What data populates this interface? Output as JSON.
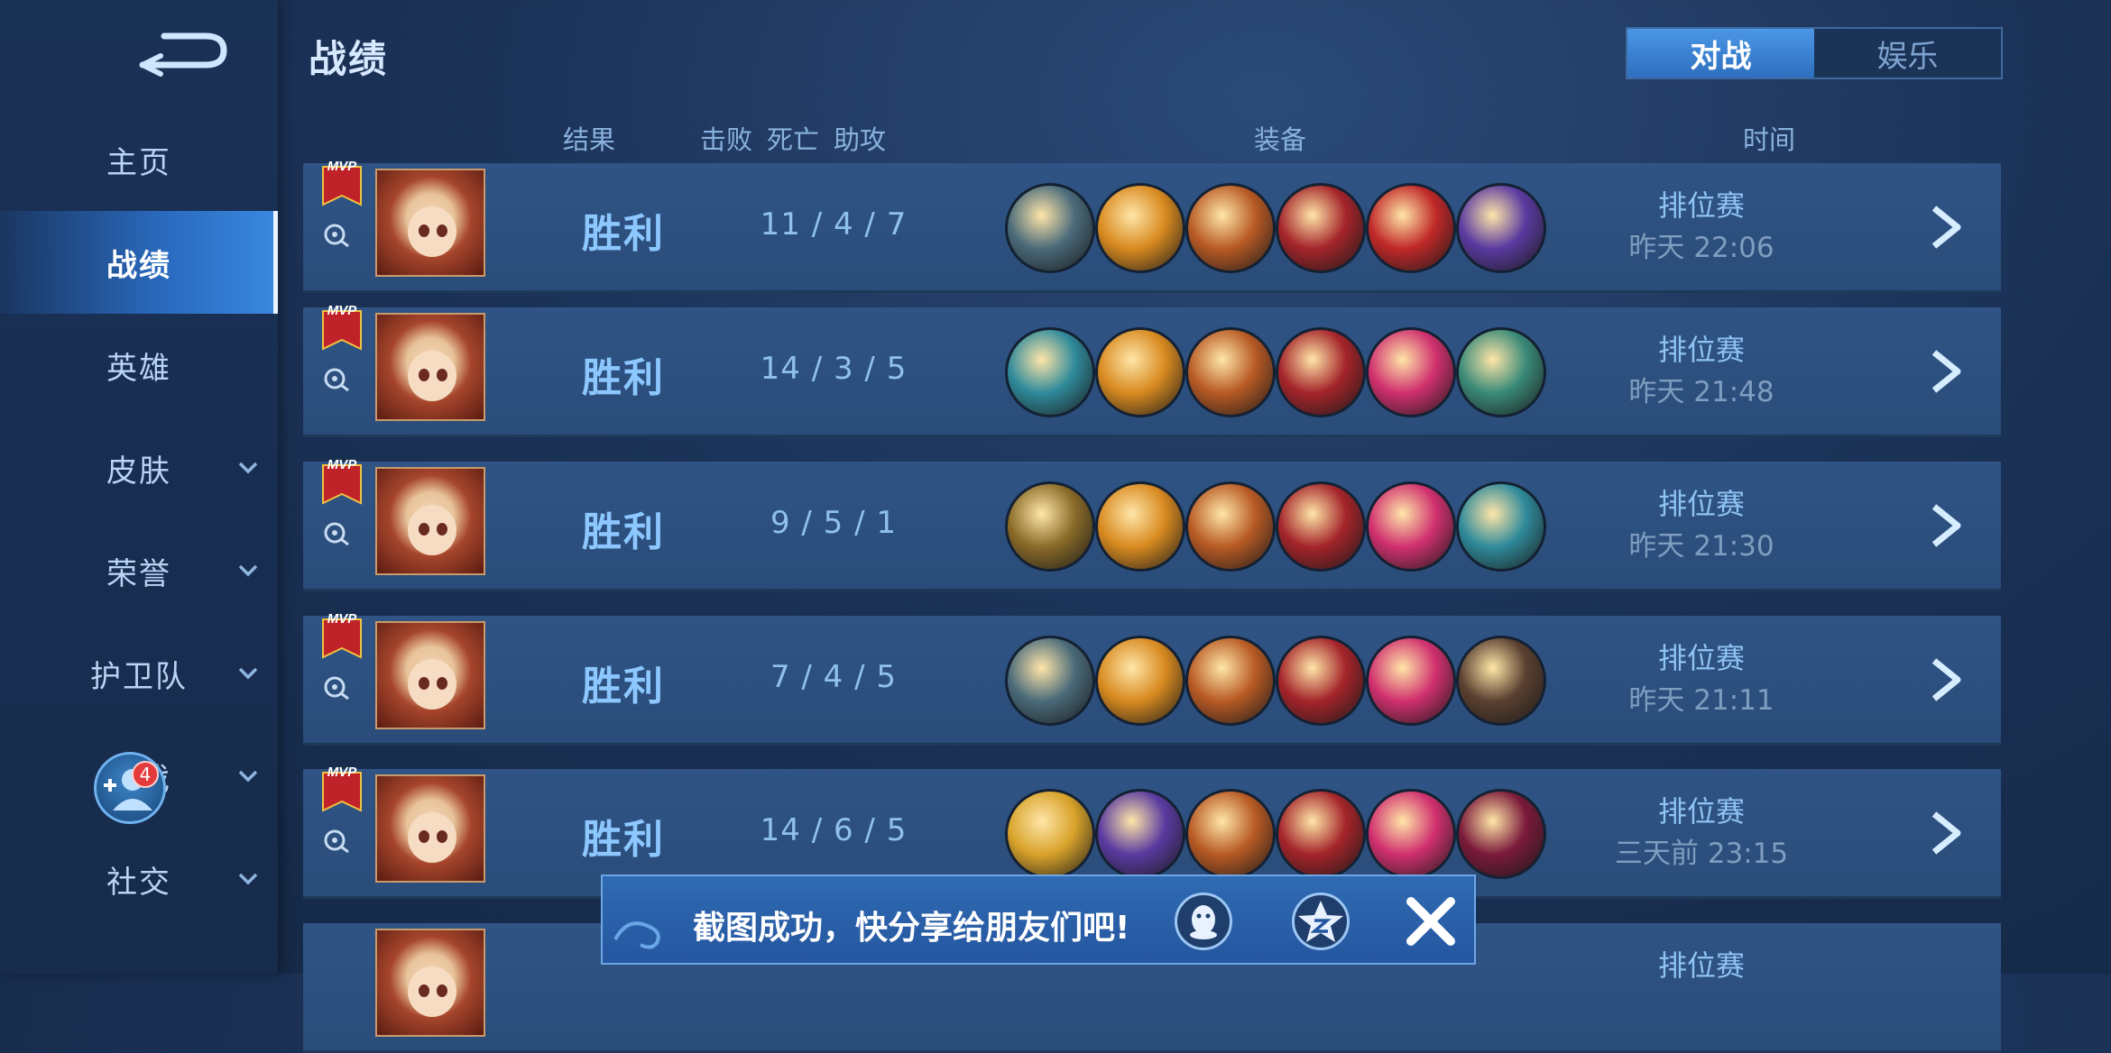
{
  "sidebar": {
    "items": [
      {
        "label": "主页",
        "has_chevron": false
      },
      {
        "label": "战绩",
        "has_chevron": false,
        "active": true
      },
      {
        "label": "英雄",
        "has_chevron": false
      },
      {
        "label": "皮肤",
        "has_chevron": true
      },
      {
        "label": "荣誉",
        "has_chevron": true
      },
      {
        "label": "护卫队",
        "has_chevron": true
      },
      {
        "label": "游戏",
        "has_chevron": true
      },
      {
        "label": "社交",
        "has_chevron": true
      }
    ],
    "friends_badge": "4"
  },
  "header": {
    "title": "战绩",
    "tabs": [
      "对战",
      "娱乐"
    ],
    "active_tab": "对战"
  },
  "columns": {
    "result": "结果",
    "kills": "击败",
    "deaths": "死亡",
    "assists": "助攻",
    "equipment": "装备",
    "time": "时间"
  },
  "matches": [
    {
      "mvp_label": "MVP",
      "result": "胜利",
      "kda": "11  /  4  /  7",
      "mode": "排位赛",
      "time": "昨天 22:06",
      "equipment": [
        "boots-steel",
        "golden-claw",
        "flame-blade",
        "crimson-blade",
        "red-helm",
        "void-spear"
      ]
    },
    {
      "mvp_label": "MVP",
      "result": "胜利",
      "kda": "14  /  3  /  5",
      "mode": "排位赛",
      "time": "昨天 21:48",
      "equipment": [
        "frost-sword",
        "golden-claw",
        "flame-blade",
        "crimson-blade",
        "pink-blade",
        "green-boots"
      ]
    },
    {
      "mvp_label": "MVP",
      "result": "胜利",
      "kda": "9  /  5  /  1",
      "mode": "排位赛",
      "time": "昨天 21:30",
      "equipment": [
        "gold-boots",
        "golden-claw",
        "flame-blade",
        "crimson-blade",
        "pink-blade",
        "frost-sword"
      ]
    },
    {
      "mvp_label": "MVP",
      "result": "胜利",
      "kda": "7  /  4  /  5",
      "mode": "排位赛",
      "time": "昨天 21:11",
      "equipment": [
        "boots-steel",
        "golden-claw",
        "flame-blade",
        "crimson-blade",
        "pink-blade",
        "leather-boots"
      ]
    },
    {
      "mvp_label": "MVP",
      "result": "胜利",
      "kda": "14  /  6  /  5",
      "mode": "排位赛",
      "time": "三天前 23:15",
      "equipment": [
        "golden-arrow",
        "void-spear",
        "flame-blade",
        "crimson-blade",
        "pink-blade",
        "dark-blade"
      ]
    },
    {
      "mvp_label": "",
      "result": "",
      "kda": "",
      "mode": "排位赛",
      "time": "",
      "equipment": []
    }
  ],
  "toast": {
    "text": "截图成功，快分享给朋友们吧!",
    "share_targets": [
      "qq-icon",
      "qzone-icon"
    ]
  },
  "colors": {
    "accent": "#3a89e0",
    "win": "#8cc8ff",
    "equipment": {
      "boots-steel": "#4a6a7a",
      "golden-claw": "#d88a20",
      "flame-blade": "#b85a24",
      "crimson-blade": "#a4242a",
      "red-helm": "#c02828",
      "void-spear": "#5a3aa0",
      "frost-sword": "#2f8a9a",
      "pink-blade": "#d0306e",
      "green-boots": "#3a8a78",
      "gold-boots": "#8a6a28",
      "leather-boots": "#5a4030",
      "golden-arrow": "#d8a22a",
      "dark-blade": "#7a1a3a"
    }
  }
}
